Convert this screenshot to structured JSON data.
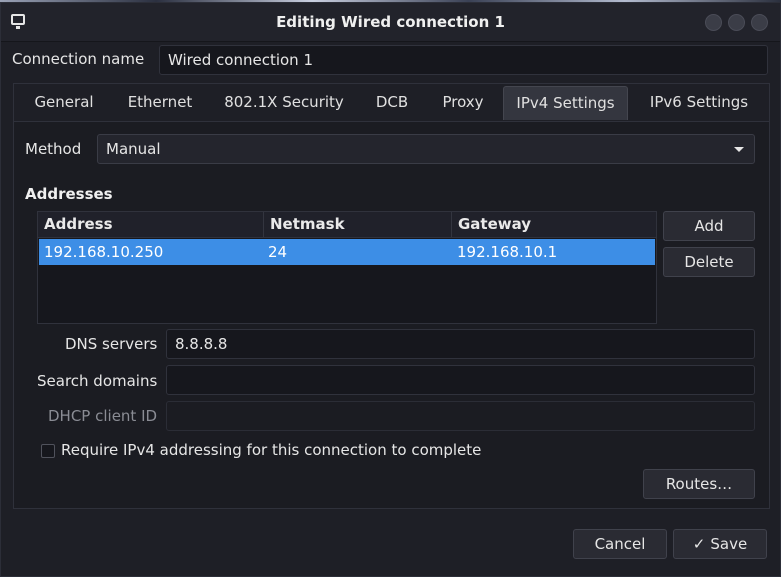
{
  "window": {
    "title": "Editing Wired connection 1"
  },
  "connection": {
    "label": "Connection name",
    "value": "Wired connection 1"
  },
  "tabs": [
    {
      "label": "General"
    },
    {
      "label": "Ethernet"
    },
    {
      "label": "802.1X Security"
    },
    {
      "label": "DCB"
    },
    {
      "label": "Proxy"
    },
    {
      "label": "IPv4 Settings"
    },
    {
      "label": "IPv6 Settings"
    }
  ],
  "active_tab": "IPv4 Settings",
  "ipv4": {
    "method_label": "Method",
    "method_value": "Manual",
    "addresses_title": "Addresses",
    "columns": [
      "Address",
      "Netmask",
      "Gateway"
    ],
    "rows": [
      {
        "address": "192.168.10.250",
        "netmask": "24",
        "gateway": "192.168.10.1"
      }
    ],
    "add_label": "Add",
    "delete_label": "Delete",
    "dns_label": "DNS servers",
    "dns_value": "8.8.8.8",
    "search_label": "Search domains",
    "search_value": "",
    "dhcp_label": "DHCP client ID",
    "dhcp_value": "",
    "require_label": "Require IPv4 addressing for this connection to complete",
    "require_checked": false,
    "routes_label": "Routes…"
  },
  "footer": {
    "cancel_label": "Cancel",
    "save_label": "Save",
    "save_icon": "✓"
  },
  "icons": {
    "app": "network-window-icon",
    "check": "checkmark-icon"
  },
  "colors": {
    "selection": "#3d8ee6",
    "background": "#1e1f26"
  }
}
